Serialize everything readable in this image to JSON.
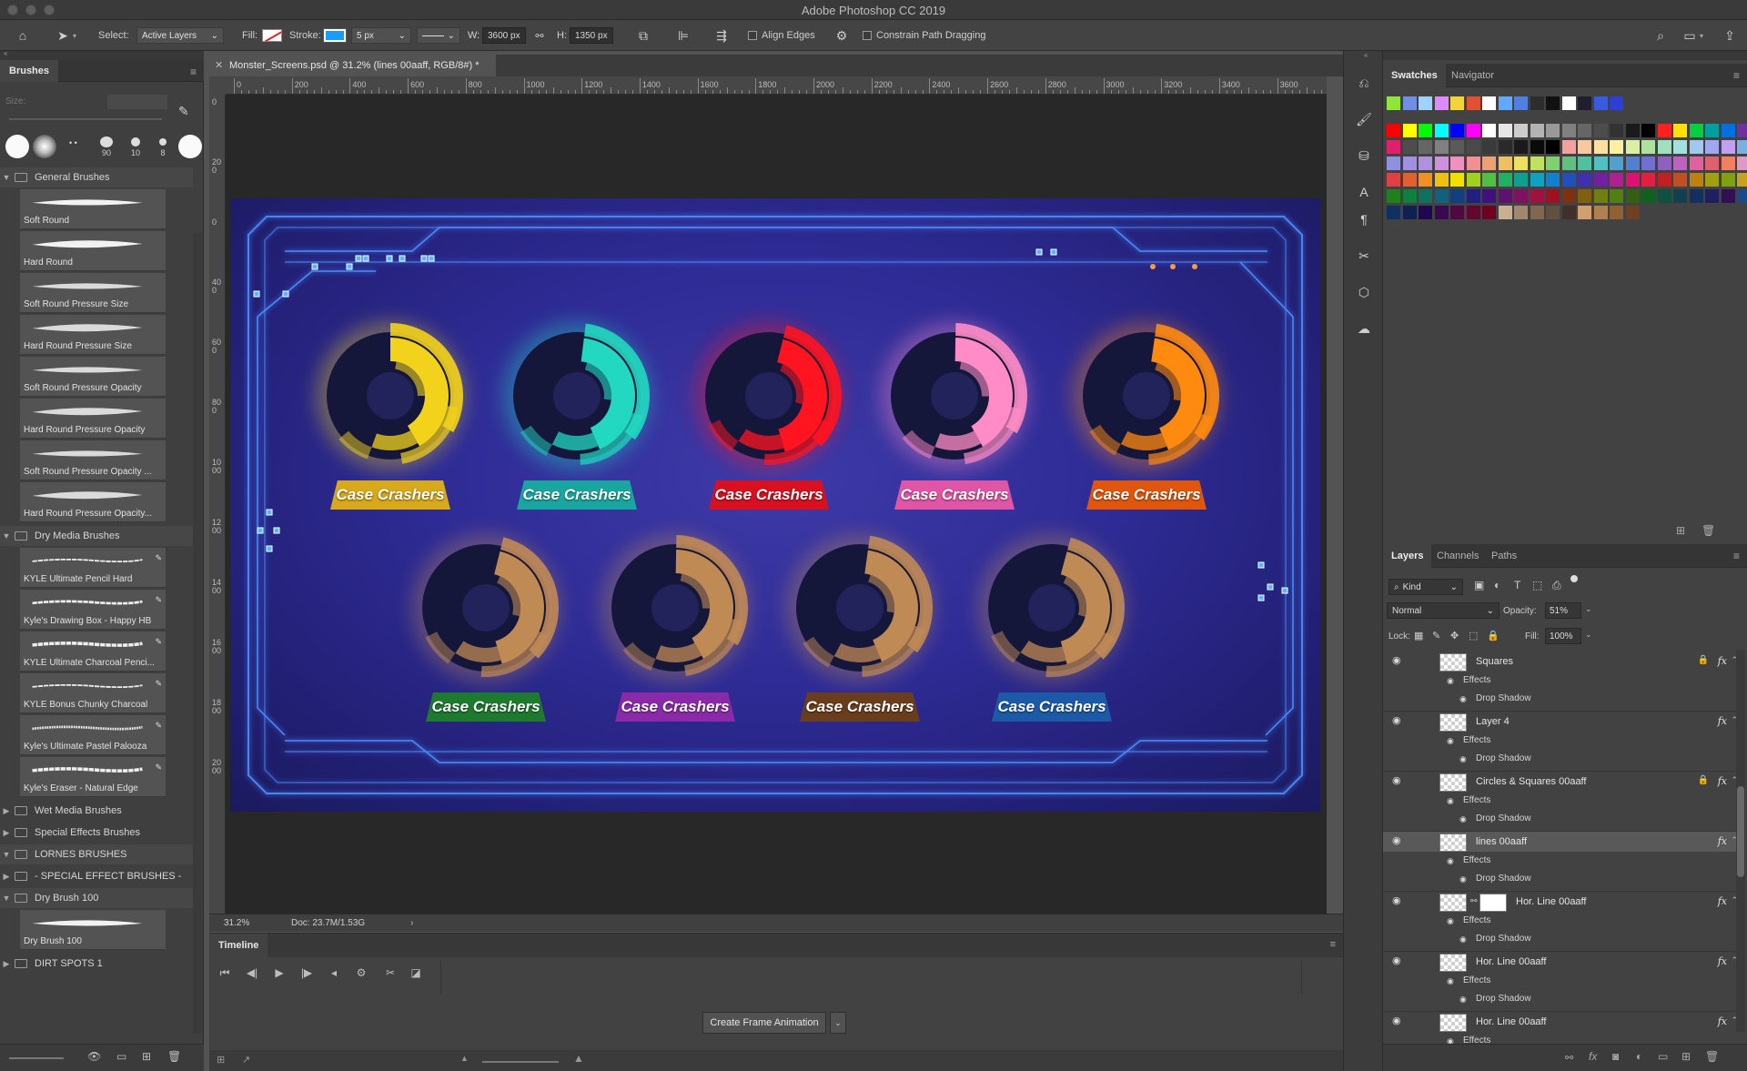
{
  "app": {
    "title": "Adobe Photoshop CC 2019"
  },
  "options_bar": {
    "select_label": "Select:",
    "select_value": "Active Layers",
    "fill_label": "Fill:",
    "stroke_label": "Stroke:",
    "stroke_width": "5 px",
    "w_label": "W:",
    "w_value": "3600 px",
    "h_label": "H:",
    "h_value": "1350 px",
    "align_edges": "Align Edges",
    "constrain": "Constrain Path Dragging"
  },
  "brushes_panel": {
    "tab": "Brushes",
    "size_label": "Size:",
    "preset_sizes": [
      "90",
      "10",
      "8"
    ],
    "groups": [
      {
        "name": "General Brushes",
        "open": true,
        "items": [
          "Soft Round",
          "Hard Round",
          "Soft Round Pressure Size",
          "Hard Round Pressure Size",
          "Soft Round Pressure Opacity",
          "Hard Round Pressure Opacity",
          "Soft Round Pressure Opacity ...",
          "Hard Round Pressure Opacity..."
        ]
      },
      {
        "name": "Dry Media Brushes",
        "open": true,
        "items": [
          "KYLE Ultimate Pencil Hard",
          "Kyle's Drawing Box - Happy HB",
          "KYLE Ultimate Charcoal Penci...",
          "KYLE Bonus Chunky Charcoal",
          "Kyle's Ultimate Pastel Palooza",
          "Kyle's Eraser - Natural Edge"
        ]
      },
      {
        "name": "Wet Media Brushes",
        "open": false,
        "items": []
      },
      {
        "name": "Special Effects Brushes",
        "open": false,
        "items": []
      },
      {
        "name": "LORNES BRUSHES",
        "open": true,
        "items": []
      },
      {
        "name": "- SPECIAL EFFECT BRUSHES -",
        "open": false,
        "items": []
      },
      {
        "name": "Dry Brush 100",
        "open": true,
        "items": [
          "Dry Brush 100"
        ]
      },
      {
        "name": "DIRT SPOTS 1",
        "open": false,
        "items": []
      }
    ]
  },
  "document": {
    "tab_title": "Monster_Screens.psd @ 31.2% (lines 00aaff, RGB/8#) *",
    "zoom": "31.2%",
    "doc_info": "Doc: 23.7M/1.53G",
    "ruler_labels": [
      "0",
      "200",
      "400",
      "600",
      "800",
      "1000",
      "1200",
      "1400",
      "1600",
      "1800",
      "2000",
      "2200",
      "2400",
      "2600",
      "2800",
      "3000",
      "3200",
      "3400",
      "3600",
      "380"
    ],
    "ruler_left_labels": [
      "0",
      "200",
      "0",
      "400",
      "600",
      "800",
      "1000",
      "1200",
      "1400",
      "1600",
      "1800",
      "2000"
    ]
  },
  "artwork": {
    "badge_label": "Case Crashers",
    "row1": [
      {
        "color": "#f2d21b",
        "badge": "#d8a91a"
      },
      {
        "color": "#22d8c0",
        "badge": "#1aa6a0"
      },
      {
        "color": "#ff1420",
        "badge": "#d81020"
      },
      {
        "color": "#ff8cc6",
        "badge": "#e055a6"
      },
      {
        "color": "#ff8a10",
        "badge": "#e0560c"
      }
    ],
    "row2": [
      {
        "color": "#c08a55",
        "badge": "#1e7a2e"
      },
      {
        "color": "#c08a55",
        "badge": "#8a2aa8"
      },
      {
        "color": "#c08a55",
        "badge": "#6a3e1c"
      },
      {
        "color": "#c08a55",
        "badge": "#1c5aa8"
      }
    ]
  },
  "timeline": {
    "tab": "Timeline",
    "create_button": "Create Frame Animation"
  },
  "right_panel": {
    "top_tabs": [
      "Swatches",
      "Navigator"
    ],
    "layers_tabs": [
      "Layers",
      "Channels",
      "Paths"
    ],
    "kind_label": "Kind",
    "blend_mode": "Normal",
    "opacity_label": "Opacity:",
    "opacity_value": "51%",
    "lock_label": "Lock:",
    "fill_label": "Fill:",
    "fill_value": "100%",
    "effects_label": "Effects",
    "drop_shadow_label": "Drop Shadow",
    "layers": [
      {
        "name": "Squares",
        "locked": true,
        "selected": false
      },
      {
        "name": "Layer 4",
        "locked": false,
        "selected": false
      },
      {
        "name": "Circles & Squares 00aaff",
        "locked": true,
        "selected": false
      },
      {
        "name": "lines 00aaff",
        "locked": false,
        "selected": true
      },
      {
        "name": "Hor. Line 00aaff",
        "locked": false,
        "selected": false
      },
      {
        "name": "Hor. Line 00aaff",
        "locked": false,
        "selected": false
      },
      {
        "name": "Hor. Line 00aaff",
        "locked": false,
        "selected": false
      }
    ]
  },
  "swatch_colors": {
    "recent": [
      "#8fe53b",
      "#6f8fe6",
      "#9fd3ff",
      "#e089ff",
      "#f0d43a",
      "#e05032",
      "#ffffff",
      "#61a8ff",
      "#4f7fe0",
      "#2d2d2d",
      "#111111",
      "#ffffff",
      "#1e1e2e",
      "#3a5ae0",
      "#2b3ed6"
    ],
    "grid": [
      [
        "#ff0000",
        "#ffff00",
        "#00ff00",
        "#00ffff",
        "#0000ff",
        "#ff00ff",
        "#ffffff",
        "#e6e6e6",
        "#cccccc",
        "#b3b3b3",
        "#999999",
        "#808080",
        "#666666",
        "#4d4d4d",
        "#333333",
        "#1a1a1a",
        "#000000",
        "#ff2020",
        "#ffe000",
        "#00d040",
        "#00a0a0",
        "#0070e0",
        "#7030a0"
      ],
      [
        "#e0206a",
        "#4d4d4d",
        "#666666",
        "#808080",
        "#5a5a5a",
        "#4a4a4a",
        "#3a3a3a",
        "#2a2a2a",
        "#1a1a1a",
        "#0a0a0a",
        "#000000",
        "#f4a0a0",
        "#f8c8a0",
        "#fce0a0",
        "#fff0a0",
        "#d8f0a0",
        "#b0e0a0",
        "#a0e0c0",
        "#a0e0e0",
        "#a0c8f0",
        "#a0a8f0",
        "#c0a0f0",
        "#7dafe0"
      ],
      [
        "#9090e0",
        "#a090e0",
        "#b090e0",
        "#d090e0",
        "#f090c0",
        "#f09090",
        "#f0a070",
        "#f0c060",
        "#f0e060",
        "#c0e060",
        "#80d070",
        "#60c080",
        "#50c0a0",
        "#50c0c0",
        "#50a0d0",
        "#5080d0",
        "#7070d0",
        "#9060c0",
        "#c060c0",
        "#e060a0",
        "#e06070",
        "#f08060",
        "#e098c8"
      ],
      [
        "#e04040",
        "#e06030",
        "#f09020",
        "#f0c010",
        "#f0e000",
        "#a0d020",
        "#50c040",
        "#20b060",
        "#10a090",
        "#10a0c0",
        "#1080d0",
        "#2050c0",
        "#4030b0",
        "#7020a0",
        "#b02090",
        "#e01070",
        "#e02040",
        "#c02020",
        "#c05020",
        "#c08010",
        "#a0a010",
        "#80a010",
        "#c9a020"
      ],
      [
        "#208020",
        "#108040",
        "#107060",
        "#106080",
        "#104080",
        "#202080",
        "#401080",
        "#601070",
        "#801060",
        "#a01040",
        "#a01020",
        "#803010",
        "#806010",
        "#708010",
        "#508010",
        "#306010",
        "#106020",
        "#105040",
        "#104050",
        "#103060",
        "#202060",
        "#301050",
        "#1a4a8a"
      ],
      [
        "#103060",
        "#102050",
        "#200850",
        "#380850",
        "#500840",
        "#600830",
        "#700020",
        "#c8b090",
        "#a08870",
        "#806850",
        "#605040",
        "#403028",
        "#d0a070",
        "#b08050",
        "#906030",
        "#704020"
      ]
    ]
  }
}
